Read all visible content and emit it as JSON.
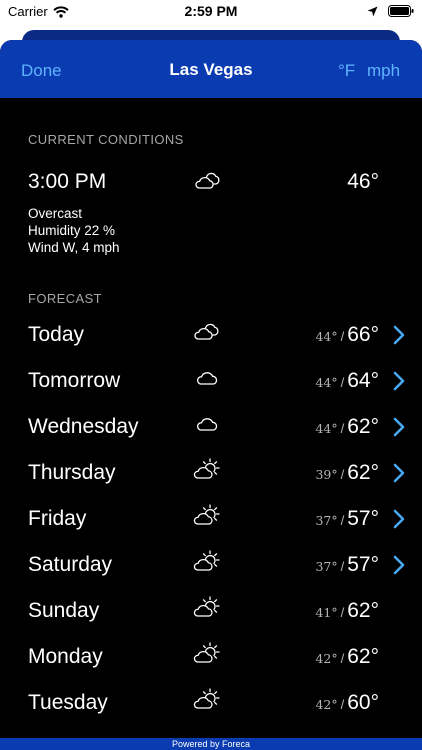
{
  "status_bar": {
    "carrier": "Carrier",
    "time": "2:59 PM"
  },
  "nav": {
    "done_label": "Done",
    "title": "Las Vegas",
    "temp_unit": "°F",
    "speed_unit": "mph"
  },
  "current": {
    "section_label": "CURRENT CONDITIONS",
    "time": "3:00 PM",
    "icon": "overcast-icon",
    "temperature": "46°",
    "condition": "Overcast",
    "humidity": "Humidity 22 %",
    "wind": "Wind W, 4 mph"
  },
  "forecast": {
    "section_label": "FORECAST",
    "days": [
      {
        "day": "Today",
        "icon": "overcast-icon",
        "low": "44°",
        "high": "66°",
        "has_chevron": true
      },
      {
        "day": "Tomorrow",
        "icon": "cloud-icon",
        "low": "44°",
        "high": "64°",
        "has_chevron": true
      },
      {
        "day": "Wednesday",
        "icon": "cloud-icon",
        "low": "44°",
        "high": "62°",
        "has_chevron": true
      },
      {
        "day": "Thursday",
        "icon": "partly-cloudy-icon",
        "low": "39°",
        "high": "62°",
        "has_chevron": true
      },
      {
        "day": "Friday",
        "icon": "partly-cloudy-icon",
        "low": "37°",
        "high": "57°",
        "has_chevron": true
      },
      {
        "day": "Saturday",
        "icon": "partly-cloudy-icon",
        "low": "37°",
        "high": "57°",
        "has_chevron": true
      },
      {
        "day": "Sunday",
        "icon": "partly-cloudy-icon",
        "low": "41°",
        "high": "62°",
        "has_chevron": false
      },
      {
        "day": "Monday",
        "icon": "partly-cloudy-icon",
        "low": "42°",
        "high": "62°",
        "has_chevron": false
      },
      {
        "day": "Tuesday",
        "icon": "partly-cloudy-icon",
        "low": "42°",
        "high": "60°",
        "has_chevron": false
      }
    ]
  },
  "footer": {
    "text": "Powered by Foreca"
  },
  "colors": {
    "nav_bg": "#0a3bb1",
    "accent": "#5fb3ff",
    "background": "#000000"
  }
}
